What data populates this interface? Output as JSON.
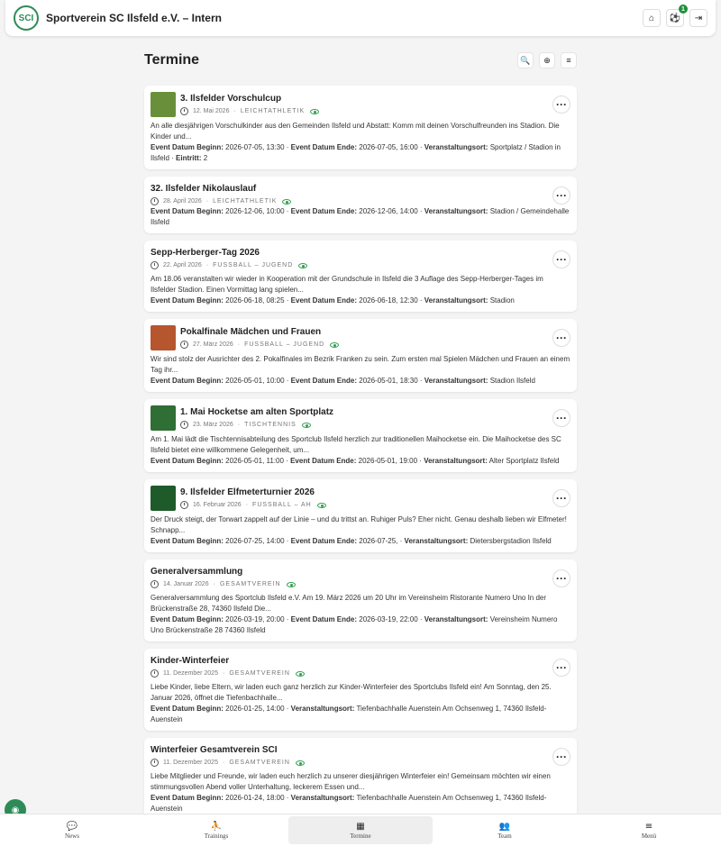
{
  "app": {
    "title": "Sportverein SC Ilsfeld e.V. – Intern",
    "logo_text": "SCI",
    "notification_count": "1"
  },
  "icons": {
    "home": "home-icon",
    "settings": "soccer-ball-icon",
    "logout": "logout-icon",
    "search": "search-icon",
    "add": "plus-circle-icon",
    "menu": "list-icon",
    "clock": "clock-icon",
    "eye": "eye-icon",
    "more": "more-horizontal-icon"
  },
  "page": {
    "title": "Termine"
  },
  "labels": {
    "begin": "Event Datum Beginn:",
    "end": "Event Datum Ende:",
    "location": "Veranstaltungsort:",
    "entry": "Eintritt:",
    "sep": "·"
  },
  "events": [
    {
      "title": "3. Ilsfelder Vorschulcup",
      "date": "12. Mai 2026",
      "category": "Leichtathletik",
      "has_thumb": true,
      "thumb_color": "#6a8f3a",
      "description": "An alle diesjährigen Vorschulkinder aus den Gemeinden Ilsfeld und Abstatt: Komm mit deinen Vorschulfreunden ins Stadion. Die Kinder und...",
      "begin": "2026-07-05, 13:30",
      "end": "2026-07-05, 16:00",
      "location": "Sportplatz / Stadion in Ilsfeld",
      "entry": "2"
    },
    {
      "title": "32. Ilsfelder Nikolauslauf",
      "date": "28. April 2026",
      "category": "Leichtathletik",
      "has_thumb": false,
      "description": "",
      "begin": "2026-12-06, 10:00",
      "end": "2026-12-06, 14:00",
      "location": "Stadion / Gemeindehalle Ilsfeld"
    },
    {
      "title": "Sepp-Herberger-Tag 2026",
      "date": "22. April 2026",
      "category": "Fussball – Jugend",
      "has_thumb": false,
      "description": "Am 18.06 veranstalten wir wieder in Kooperation mit der Grundschule in Ilsfeld die 3 Auflage des Sepp-Herberger-Tages im Ilsfelder Stadion. Einen Vormittag lang spielen...",
      "begin": "2026-06-18, 08:25",
      "end": "2026-06-18, 12:30",
      "location": "Stadion"
    },
    {
      "title": "Pokalfinale Mädchen und Frauen",
      "date": "27. März 2026",
      "category": "Fussball – Jugend",
      "has_thumb": true,
      "thumb_color": "#b5562e",
      "description": "Wir sind stolz der Ausrichter des 2. Pokalfinales im Bezrik Franken zu sein. Zum ersten mal Spielen Mädchen und Frauen an einem Tag ihr...",
      "begin": "2026-05-01, 10:00",
      "end": "2026-05-01, 18:30",
      "location": "Stadion Ilsfeld"
    },
    {
      "title": "1. Mai Hocketse am alten Sportplatz",
      "date": "23. März 2026",
      "category": "Tischtennis",
      "has_thumb": true,
      "thumb_color": "#2f6e34",
      "description": "Am 1. Mai lädt die Tischtennisabteilung des Sportclub Ilsfeld herzlich zur traditionellen Maihocketse ein. Die Maihocketse des SC Ilsfeld bietet eine willkommene Gelegenheit, um...",
      "begin": "2026-05-01, 11:00",
      "end": "2026-05-01, 19:00",
      "location": "Alter Sportplatz Ilsfeld"
    },
    {
      "title": "9. Ilsfelder Elfmeterturnier 2026",
      "date": "16. Februar 2026",
      "category": "Fussball – AH",
      "has_thumb": true,
      "thumb_color": "#1e5a2a",
      "description": "Der Druck steigt, der Torwart zappelt auf der Linie – und du trittst an. Ruhiger Puls? Eher nicht. Genau deshalb lieben wir Elfmeter! Schnapp...",
      "begin": "2026-07-25, 14:00",
      "end": "2026-07-25,",
      "location": "Dietersbergstadion Ilsfeld"
    },
    {
      "title": "Generalversammlung",
      "date": "14. Januar 2026",
      "category": "Gesamtverein",
      "has_thumb": false,
      "description": "Generalversammlung des Sportclub Ilsfeld e.V. Am 19. März 2026 um 20 Uhr im Vereinsheim Ristorante Numero Uno In der Brückenstraße 28, 74360 Ilsfeld Die...",
      "begin": "2026-03-19, 20:00",
      "end": "2026-03-19, 22:00",
      "location": "Vereinsheim Numero Uno Brückenstraße 28 74360 Ilsfeld"
    },
    {
      "title": "Kinder-Winterfeier",
      "date": "11. Dezember 2025",
      "category": "Gesamtverein",
      "has_thumb": false,
      "description": "Liebe Kinder, liebe Eltern, wir laden euch ganz herzlich zur Kinder-Winterfeier des Sportclubs Ilsfeld ein! Am Sonntag, den 25. Januar 2026, öffnet die Tiefenbachhalle...",
      "begin": "2026-01-25, 14:00",
      "location": "Tiefenbachhalle Auenstein Am Ochsenweg 1, 74360 Ilsfeld-Auenstein"
    },
    {
      "title": "Winterfeier Gesamtverein SCI",
      "date": "11. Dezember 2025",
      "category": "Gesamtverein",
      "has_thumb": false,
      "description": "Liebe Mitglieder und Freunde, wir laden euch herzlich zu unserer diesjährigen Winterfeier ein! Gemeinsam möchten wir einen stimmungsvollen Abend voller Unterhaltung, leckerem Essen und...",
      "begin": "2026-01-24, 18:00",
      "location": "Tiefenbachhalle Auenstein Am Ochsenweg 1, 74360 Ilsfeld-Auenstein"
    }
  ],
  "nav": [
    {
      "label": "News",
      "icon": "chat-bubble-icon",
      "glyph": "💬",
      "active": false
    },
    {
      "label": "Trainings",
      "icon": "runner-icon",
      "glyph": "⛹",
      "active": false
    },
    {
      "label": "Termine",
      "icon": "calendar-icon",
      "glyph": "▦",
      "active": true
    },
    {
      "label": "Team",
      "icon": "team-icon",
      "glyph": "👥",
      "active": false
    },
    {
      "label": "Menü",
      "icon": "hamburger-menu-icon",
      "glyph": "≡",
      "active": false
    }
  ]
}
